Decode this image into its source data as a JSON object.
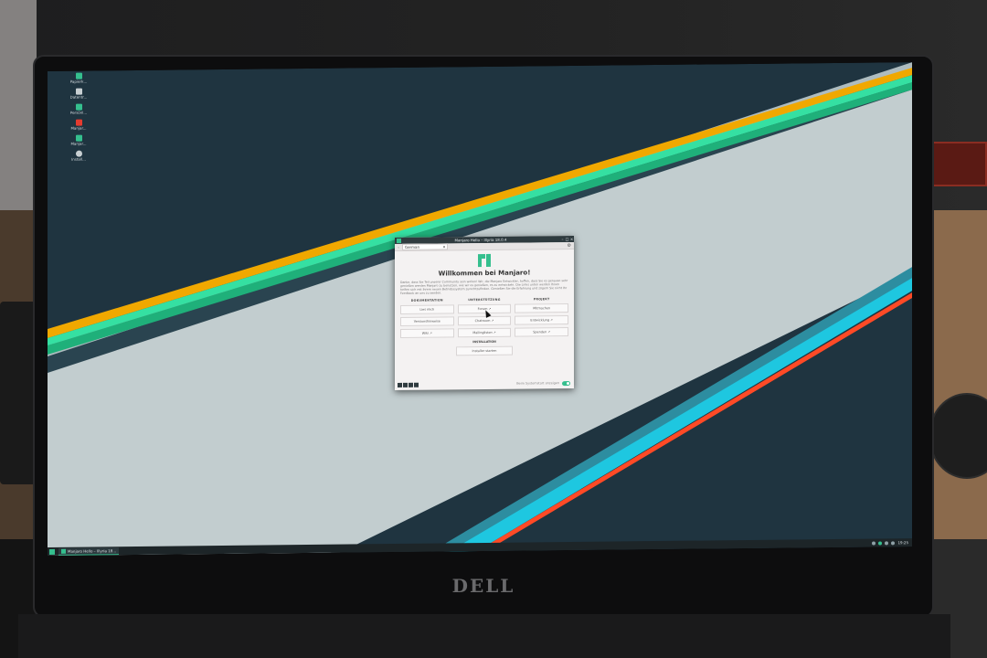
{
  "desktop": {
    "icons": [
      {
        "label": "Papierk...",
        "icon": "trash-icon",
        "color": "#35bf8e"
      },
      {
        "label": "Datentr...",
        "icon": "drive-icon",
        "color": "#c8cfd2"
      },
      {
        "label": "Persönl...",
        "icon": "home-folder-icon",
        "color": "#35bf8e"
      },
      {
        "label": "Manjar...",
        "icon": "pdf-icon",
        "color": "#e53b2f"
      },
      {
        "label": "Manjar...",
        "icon": "network-icon",
        "color": "#35bf8e"
      },
      {
        "label": "Install...",
        "icon": "installer-disc-icon",
        "color": "#c8cfd2"
      }
    ]
  },
  "taskbar": {
    "task_label": "Manjaro Hello – Illyria 18...",
    "clock": "19:25"
  },
  "window": {
    "title": "Manjaro Hello – Illyria 18.0.4",
    "language": "German",
    "heading": "Willkommen bei Manjaro!",
    "intro": "Danke, dass Sie Teil unserer Community sein wollen! Wir, die Manjaro Entwickler, hoffen, dass Sie es genauso sehr genießen werden Manjaro zu benutzen, wie wir es genießen, es zu entwickeln. Die Links unten werden Ihnen helfen sich mit Ihrem neuen Betriebssystem zurechtzufinden. Genießen Sie die Erfahrung und zögern Sie nicht Ihr Feedback an uns zu senden.",
    "columns": {
      "documentation": "DOKUMENTATION",
      "support": "UNTERSTÜTZUNG",
      "project": "PROJEKT"
    },
    "buttons": {
      "readme": "Lies mich",
      "forum": "Forum ↗",
      "participate": "Mitmachen",
      "release_info": "Versionshinweise",
      "chat": "Chatroom ↗",
      "development": "Entwicklung ↗",
      "wiki": "Wiki ↗",
      "mailing_lists": "Mailinglisten ↗",
      "donate": "Spenden ↗"
    },
    "installation_heading": "INSTALLATION",
    "install_button": "Installer starten",
    "startup_label": "Beim Systemstart anzeigen",
    "startup_enabled": true
  },
  "bezel": {
    "brand": "DELL"
  }
}
